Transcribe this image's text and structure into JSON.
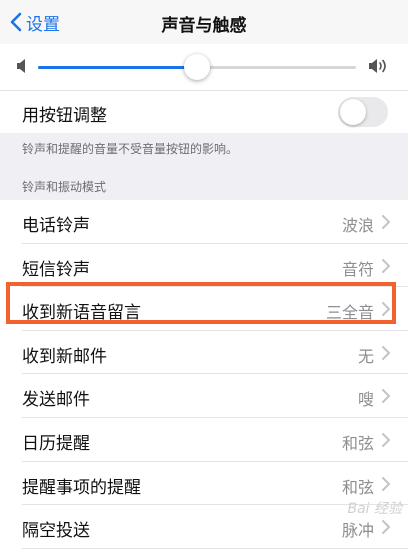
{
  "nav": {
    "back_label": "设置",
    "title": "声音与触感"
  },
  "volume": {
    "level": 0.5,
    "accent": "#1a73e8",
    "low_icon": "speaker-low-icon",
    "high_icon": "speaker-high-icon"
  },
  "button_adjust": {
    "label": "用按钮调整",
    "enabled": false
  },
  "note": "铃声和提醒的音量不受音量按钮的影响。",
  "section_header": "铃声和振动模式",
  "items": [
    {
      "label": "电话铃声",
      "value": "波浪"
    },
    {
      "label": "短信铃声",
      "value": "音符"
    },
    {
      "label": "收到新语音留言",
      "value": "三全音"
    },
    {
      "label": "收到新邮件",
      "value": "无"
    },
    {
      "label": "发送邮件",
      "value": "嗖"
    },
    {
      "label": "日历提醒",
      "value": "和弦"
    },
    {
      "label": "提醒事项的提醒",
      "value": "和弦"
    },
    {
      "label": "隔空投送",
      "value": "脉冲"
    }
  ],
  "highlight_color": "#f2622e",
  "watermark": "Bai 经验"
}
